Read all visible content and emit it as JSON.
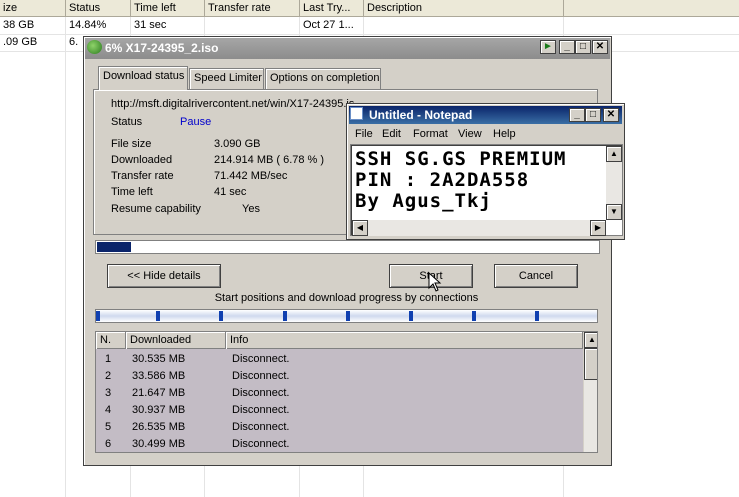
{
  "spreadsheet": {
    "headers": [
      "ize",
      "Status",
      "Time left",
      "Transfer rate",
      "Last Try...",
      "Description"
    ],
    "rows": [
      [
        "38 GB",
        "14.84%",
        "31 sec",
        "",
        "Oct 27 1...",
        ""
      ],
      [
        ".09 GB",
        "6.",
        "",
        "",
        "",
        ""
      ]
    ]
  },
  "idm": {
    "title": "6% X17-24395_2.iso",
    "tabs": [
      "Download status",
      "Speed Limiter",
      "Options on completion"
    ],
    "url": "http://msft.digitalrivercontent.net/win/X17-24395.iso",
    "status_label": "Status",
    "status_value": "Pause",
    "file_size_label": "File size",
    "file_size_value": "3.090  GB",
    "downloaded_label": "Downloaded",
    "downloaded_value": "214.914  MB  ( 6.78 % )",
    "transfer_rate_label": "Transfer rate",
    "transfer_rate_value": "71.442  MB/sec",
    "time_left_label": "Time left",
    "time_left_value": "41 sec",
    "resume_label": "Resume capability",
    "resume_value": "Yes",
    "progress_fraction": 0.068,
    "hide_details_label": "<< Hide details",
    "start_label": "Start",
    "cancel_label": "Cancel",
    "connections_caption": "Start positions and download progress by connections",
    "connection_columns": [
      "N.",
      "Downloaded",
      "Info"
    ],
    "connections": [
      {
        "n": "1",
        "downloaded": "30.535  MB",
        "info": "Disconnect."
      },
      {
        "n": "2",
        "downloaded": "33.586  MB",
        "info": "Disconnect."
      },
      {
        "n": "3",
        "downloaded": "21.647  MB",
        "info": "Disconnect."
      },
      {
        "n": "4",
        "downloaded": "30.937  MB",
        "info": "Disconnect."
      },
      {
        "n": "5",
        "downloaded": "26.535  MB",
        "info": "Disconnect."
      },
      {
        "n": "6",
        "downloaded": "30.499  MB",
        "info": "Disconnect."
      }
    ]
  },
  "notepad": {
    "title": "Untitled - Notepad",
    "menu": [
      "File",
      "Edit",
      "Format",
      "View",
      "Help"
    ],
    "lines": [
      "SSH SG.GS PREMIUM",
      "PIN : 2A2DA558",
      "By Agus_Tkj"
    ]
  },
  "colors": {
    "title_inactive": "#8c8c8c",
    "title_active": "#0a246a",
    "progress": "#0a246a",
    "link": "#0000cc"
  }
}
